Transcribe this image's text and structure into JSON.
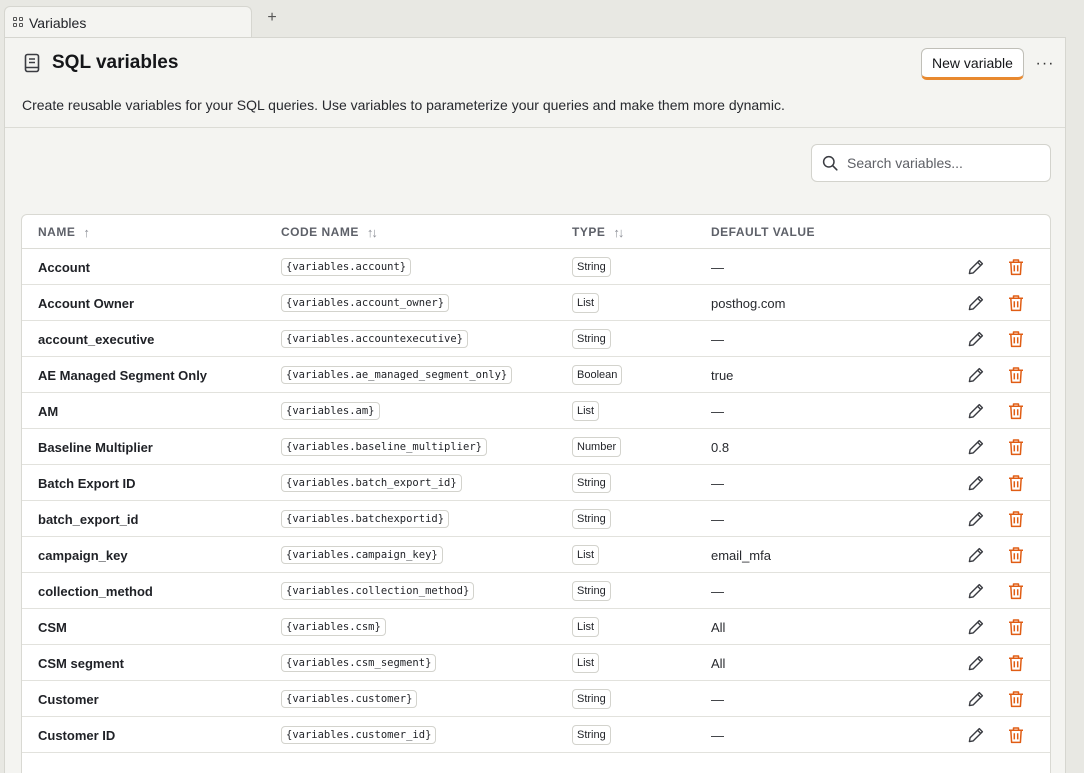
{
  "tab": {
    "label": "Variables",
    "add_label": "+"
  },
  "header": {
    "title": "SQL variables",
    "new_button": "New variable",
    "more_label": "···",
    "description": "Create reusable variables for your SQL queries. Use variables to parameterize your queries and make them more dynamic."
  },
  "search": {
    "placeholder": "Search variables..."
  },
  "table": {
    "columns": {
      "name": "NAME",
      "name_sort": "↑",
      "code": "CODE NAME",
      "code_sort": "↑↓",
      "type": "TYPE",
      "type_sort": "↑↓",
      "default": "DEFAULT VALUE"
    },
    "rows": [
      {
        "name": "Account",
        "code": "{variables.account}",
        "type": "String",
        "default": "—"
      },
      {
        "name": "Account Owner",
        "code": "{variables.account_owner}",
        "type": "List",
        "default": "posthog.com"
      },
      {
        "name": "account_executive",
        "code": "{variables.accountexecutive}",
        "type": "String",
        "default": "—"
      },
      {
        "name": "AE Managed Segment Only",
        "code": "{variables.ae_managed_segment_only}",
        "type": "Boolean",
        "default": "true"
      },
      {
        "name": "AM",
        "code": "{variables.am}",
        "type": "List",
        "default": "—"
      },
      {
        "name": "Baseline Multiplier",
        "code": "{variables.baseline_multiplier}",
        "type": "Number",
        "default": "0.8"
      },
      {
        "name": "Batch Export ID",
        "code": "{variables.batch_export_id}",
        "type": "String",
        "default": "—"
      },
      {
        "name": "batch_export_id",
        "code": "{variables.batchexportid}",
        "type": "String",
        "default": "—"
      },
      {
        "name": "campaign_key",
        "code": "{variables.campaign_key}",
        "type": "List",
        "default": "email_mfa"
      },
      {
        "name": "collection_method",
        "code": "{variables.collection_method}",
        "type": "String",
        "default": "—"
      },
      {
        "name": "CSM",
        "code": "{variables.csm}",
        "type": "List",
        "default": "All"
      },
      {
        "name": "CSM segment",
        "code": "{variables.csm_segment}",
        "type": "List",
        "default": "All"
      },
      {
        "name": "Customer",
        "code": "{variables.customer}",
        "type": "String",
        "default": "—"
      },
      {
        "name": "Customer ID",
        "code": "{variables.customer_id}",
        "type": "String",
        "default": "—"
      }
    ]
  },
  "icons": {
    "tab": "variables-icon",
    "doc": "document-icon",
    "search": "search-icon",
    "edit": "pencil-icon",
    "delete": "trash-icon"
  },
  "colors": {
    "accent": "#e8892f",
    "delete": "#e05d14"
  }
}
